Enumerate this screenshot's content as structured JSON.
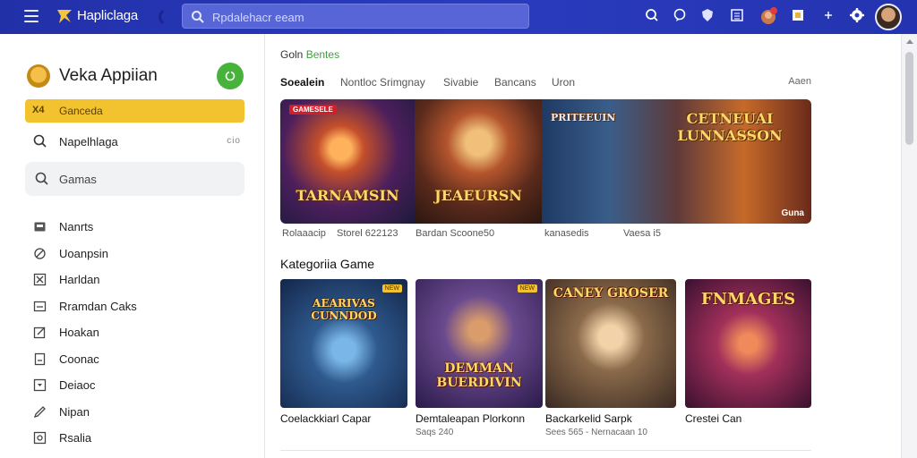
{
  "topbar": {
    "app_name": "Hapliclaga",
    "search_placeholder": "Rpdalehacr eeam",
    "icons": [
      "search-icon",
      "chat-icon",
      "shield-icon",
      "list-icon",
      "notification-avatar-icon",
      "flag-icon",
      "plus-icon",
      "settings-icon"
    ],
    "accent_color": "#2a3bbf"
  },
  "sidebar": {
    "profile_name": "Veka Appiian",
    "active_item": {
      "icon_text": "X4",
      "label": "Ganceda"
    },
    "search_item": {
      "label": "Napelhlaga",
      "extra": "cio"
    },
    "games_box": {
      "label": "Gamas"
    },
    "items": [
      {
        "label": "Nanrts",
        "icon": "tag-icon"
      },
      {
        "label": "Uoanpsin",
        "icon": "edit-icon"
      },
      {
        "label": "Harldan",
        "icon": "cross-box-icon"
      },
      {
        "label": "Rramdan Caks",
        "icon": "window-icon"
      },
      {
        "label": "Hoakan",
        "icon": "pencil-box-icon"
      },
      {
        "label": "Coonac",
        "icon": "doc-icon"
      },
      {
        "label": "Deiaoc",
        "icon": "dropdown-box-icon"
      },
      {
        "label": "Nipan",
        "icon": "pen-icon"
      },
      {
        "label": "Rsalia",
        "icon": "image-box-icon"
      }
    ],
    "brand_color": "#f3c22f"
  },
  "main": {
    "section_tag": {
      "part1": "Goln",
      "part2": "Bentes"
    },
    "tabs": [
      {
        "label": "Soealein",
        "active": true
      },
      {
        "label": "Nontloc Srimgnay",
        "active": false
      },
      {
        "label": "Sivabie",
        "active": false
      },
      {
        "label": "Bancans",
        "active": false
      },
      {
        "label": "Uron",
        "active": false
      }
    ],
    "tab_right": "Aaen",
    "banner": {
      "panels": [
        {
          "label": "TARNAMSIN",
          "badge": "GAMESELE"
        },
        {
          "label": "JEAEURSN"
        },
        {
          "top_label": "CETNEUAI LUNNASSON",
          "sub_label": "PRITEEUIN",
          "corner": "Guna"
        }
      ],
      "meta": [
        "Rolaaacip",
        "Storel 622123",
        "Bardan Scoone50",
        "kanasedis",
        "Vaesa i5"
      ]
    },
    "category_title": "Kategoriia Game",
    "cards": [
      {
        "title": "Coelackkiarl Capar",
        "meta": "",
        "tag": "AEARIVAS CUNNDOD",
        "chip": "NEW"
      },
      {
        "title": "Demtaleapan Plorkonn",
        "meta": "Saqs 240",
        "tag": "DEMMAN BUERDIVIN",
        "chip": "NEW"
      },
      {
        "title": "Backarkelid Sarpk",
        "meta": "Sees 565 - Nernacaan 10",
        "tag": "CANEY GROSER",
        "chip": ""
      },
      {
        "title": "Crestei Can",
        "meta": "",
        "tag": "FNMAGES",
        "chip": ""
      }
    ]
  }
}
